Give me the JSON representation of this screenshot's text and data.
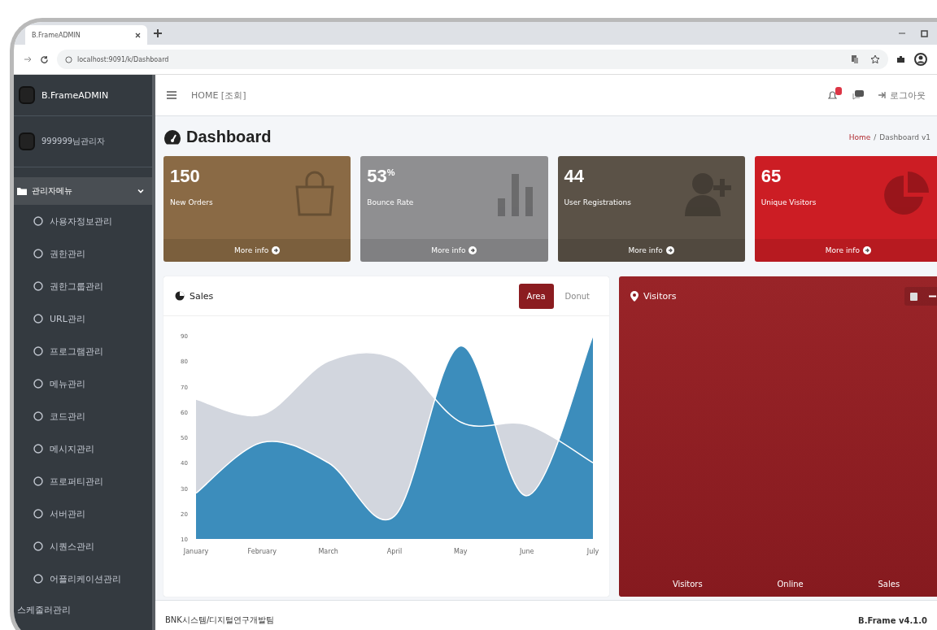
{
  "browser": {
    "tab_title": "B.FrameADMIN",
    "url": "localhost:9091/k/Dashboard"
  },
  "sidebar": {
    "brand": "B.FrameADMIN",
    "user": "999999님관리자",
    "menu": [
      {
        "label": "관리자메뉴",
        "expanded": true,
        "children": [
          {
            "label": "사용자정보관리"
          },
          {
            "label": "권한관리"
          },
          {
            "label": "권한그룹관리"
          },
          {
            "label": "URL관리"
          },
          {
            "label": "프로그램관리"
          },
          {
            "label": "메뉴관리"
          },
          {
            "label": "코드관리"
          },
          {
            "label": "메시지관리"
          },
          {
            "label": "프로퍼티관리"
          },
          {
            "label": "서버관리"
          },
          {
            "label": "시퀀스관리"
          },
          {
            "label": "어플리케이션관리"
          }
        ]
      },
      {
        "label": "스케줄러관리"
      }
    ]
  },
  "header": {
    "breadcrumb_text": "HOME [조회]",
    "logout": "로그아웃"
  },
  "page": {
    "title": "Dashboard",
    "breadcrumb": [
      {
        "label": "Home",
        "kind": "link"
      },
      {
        "label": "/",
        "kind": "separator"
      },
      {
        "label": "Dashboard v1",
        "kind": "current"
      }
    ]
  },
  "stats": [
    {
      "value": "150",
      "label": "New Orders",
      "more": "More info",
      "kind": "bag",
      "color": "#8a6a45"
    },
    {
      "value": "53$^{%}$",
      "label": "Bounce Rate",
      "more": "More info",
      "kind": "bars",
      "color": "#8f8f91"
    },
    {
      "value": "44",
      "label": "User Registrations",
      "more": "More info",
      "kind": "user",
      "color": "#5b5247"
    },
    {
      "value": "65",
      "label": "Unique Visitors",
      "more": "More info",
      "kind": "pie",
      "color": "#cc1d24"
    }
  ],
  "sales": {
    "title": "Sales",
    "tabs": [
      {
        "label": "Area",
        "selected": true
      },
      {
        "label": "Donut",
        "selected": false
      }
    ],
    "chart_data": {
      "type": "area",
      "categories": [
        "January",
        "February",
        "March",
        "April",
        "May",
        "June",
        "July"
      ],
      "series": [
        {
          "color": "#d2d6de",
          "values": [
            65,
            59,
            80,
            81,
            56,
            55,
            40
          ]
        },
        {
          "color": "#3c8dbc",
          "values": [
            28,
            48,
            40,
            19,
            86,
            27,
            90
          ]
        }
      ],
      "ylim": [
        10,
        90
      ],
      "yticks": [
        10,
        20,
        30,
        40,
        50,
        60,
        70,
        80,
        90
      ]
    }
  },
  "visitors": {
    "title": "Visitors",
    "footer": [
      "Visitors",
      "Online",
      "Sales"
    ]
  },
  "footer": {
    "left": "BNK시스템/디지털연구개발팀",
    "right": "B.Frame v4.1.0"
  }
}
